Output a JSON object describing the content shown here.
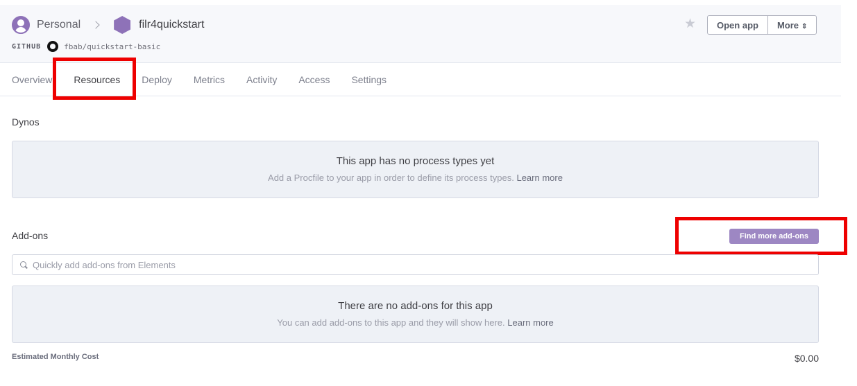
{
  "breadcrumb": {
    "account": "Personal",
    "app": "filr4quickstart"
  },
  "github": {
    "label": "GITHUB",
    "repo": "fbab/quickstart-basic"
  },
  "header_actions": {
    "open_app": "Open app",
    "more": "More"
  },
  "tabs": [
    "Overview",
    "Resources",
    "Deploy",
    "Metrics",
    "Activity",
    "Access",
    "Settings"
  ],
  "active_tab": "Resources",
  "dynos": {
    "title": "Dynos",
    "empty_title": "This app has no process types yet",
    "empty_text": "Add a Procfile to your app in order to define its process types.",
    "learn_more": "Learn more"
  },
  "addons": {
    "title": "Add-ons",
    "find_button": "Find more add-ons",
    "search_placeholder": "Quickly add add-ons from Elements",
    "search_value": "",
    "empty_title": "There are no add-ons for this app",
    "empty_text": "You can add add-ons to this app and they will show here.",
    "learn_more": "Learn more"
  },
  "cost": {
    "label": "Estimated Monthly Cost",
    "value": "$0.00"
  },
  "colors": {
    "accent": "#9d87c3",
    "brand": "#8e72b8",
    "highlight": "#ee0000"
  },
  "icons": {
    "avatar": "user-avatar-icon",
    "app": "hexagon-app-icon",
    "github": "github-icon",
    "favorite": "star-icon",
    "search": "search-icon"
  }
}
